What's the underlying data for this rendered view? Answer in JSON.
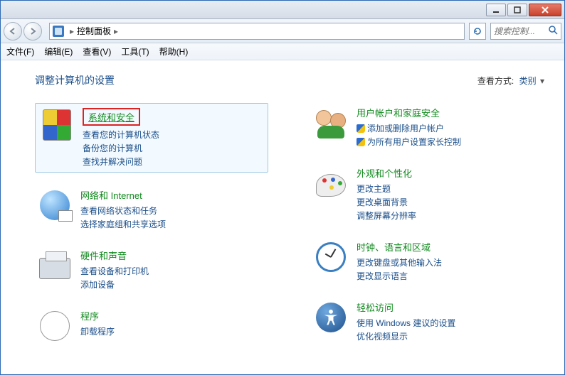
{
  "titlebar": {},
  "navbar": {
    "breadcrumb": {
      "root": "控制面板"
    },
    "search_placeholder": "搜索控制..."
  },
  "menubar": {
    "file": "文件(F)",
    "edit": "编辑(E)",
    "view": "查看(V)",
    "tools": "工具(T)",
    "help": "帮助(H)"
  },
  "heading": "调整计算机的设置",
  "viewby": {
    "label": "查看方式:",
    "value": "类别"
  },
  "left": [
    {
      "title": "系统和安全",
      "highlighted": true,
      "links": [
        "查看您的计算机状态",
        "备份您的计算机",
        "查找并解决问题"
      ]
    },
    {
      "title": "网络和 Internet",
      "links": [
        "查看网络状态和任务",
        "选择家庭组和共享选项"
      ]
    },
    {
      "title": "硬件和声音",
      "links": [
        "查看设备和打印机",
        "添加设备"
      ]
    },
    {
      "title": "程序",
      "links": [
        "卸载程序"
      ]
    }
  ],
  "right": [
    {
      "title": "用户帐户和家庭安全",
      "shield_links": [
        "添加或删除用户帐户",
        "为所有用户设置家长控制"
      ]
    },
    {
      "title": "外观和个性化",
      "links": [
        "更改主题",
        "更改桌面背景",
        "调整屏幕分辨率"
      ]
    },
    {
      "title": "时钟、语言和区域",
      "links": [
        "更改键盘或其他输入法",
        "更改显示语言"
      ]
    },
    {
      "title": "轻松访问",
      "links": [
        "使用 Windows 建议的设置",
        "优化视频显示"
      ]
    }
  ]
}
